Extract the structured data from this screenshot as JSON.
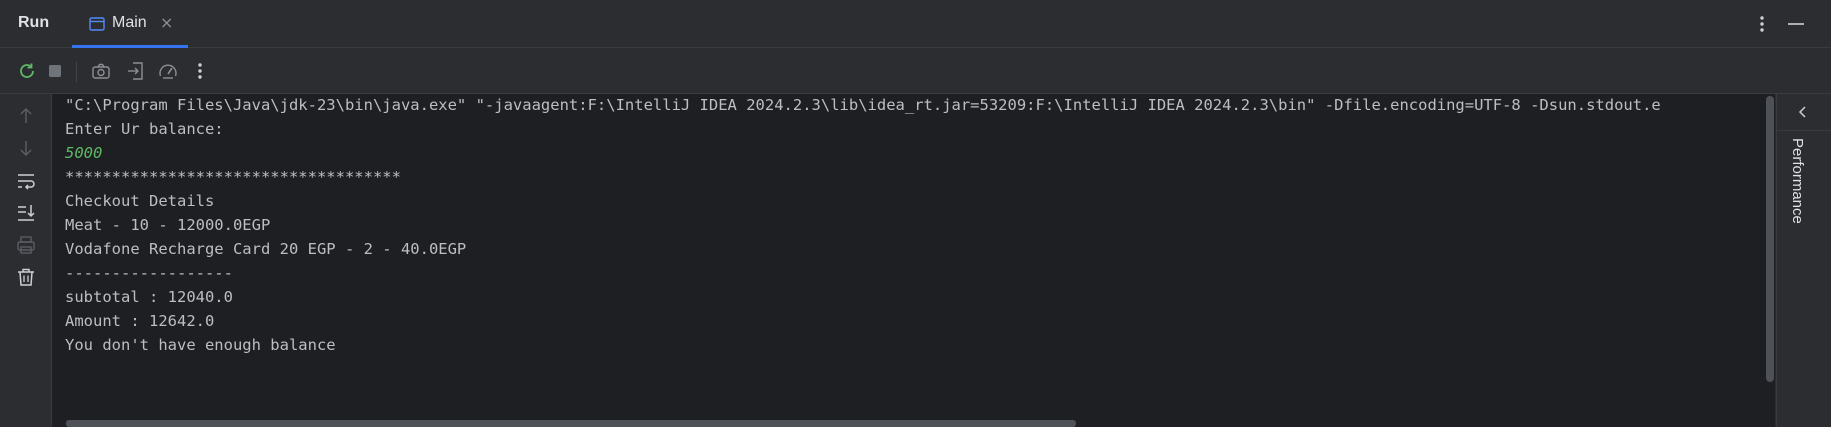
{
  "header": {
    "tool_window_title": "Run",
    "tab": {
      "label": "Main",
      "close_glyph": "×"
    }
  },
  "toolbar": {
    "buttons": [
      "rerun-icon",
      "stop-icon",
      "camera-icon",
      "exit-icon",
      "gauge-icon",
      "more-vertical-icon"
    ]
  },
  "leftbar": {
    "buttons": [
      "arrow-up-icon",
      "arrow-down-icon",
      "soft-wrap-icon",
      "scroll-to-end-icon",
      "print-icon",
      "trash-icon"
    ]
  },
  "console": {
    "lines": [
      "\"C:\\Program Files\\Java\\jdk-23\\bin\\java.exe\" \"-javaagent:F:\\IntelliJ IDEA 2024.2.3\\lib\\idea_rt.jar=53209:F:\\IntelliJ IDEA 2024.2.3\\bin\" -Dfile.encoding=UTF-8 -Dsun.stdout.e",
      "Enter Ur balance:",
      "5000",
      "************************************",
      "Checkout Details",
      "Meat - 10 - 12000.0EGP",
      "Vodafone Recharge Card 20 EGP - 2 - 40.0EGP",
      "------------------",
      "subtotal : 12040.0",
      "Amount : 12642.0",
      "You don't have enough balance"
    ]
  },
  "rightpanel": {
    "label": "Performance"
  },
  "colors": {
    "accent": "#3574f0",
    "console_bg": "#1e1f22",
    "panel_bg": "#2b2d30",
    "text": "#bcbec4",
    "user_input": "#5fb865"
  }
}
